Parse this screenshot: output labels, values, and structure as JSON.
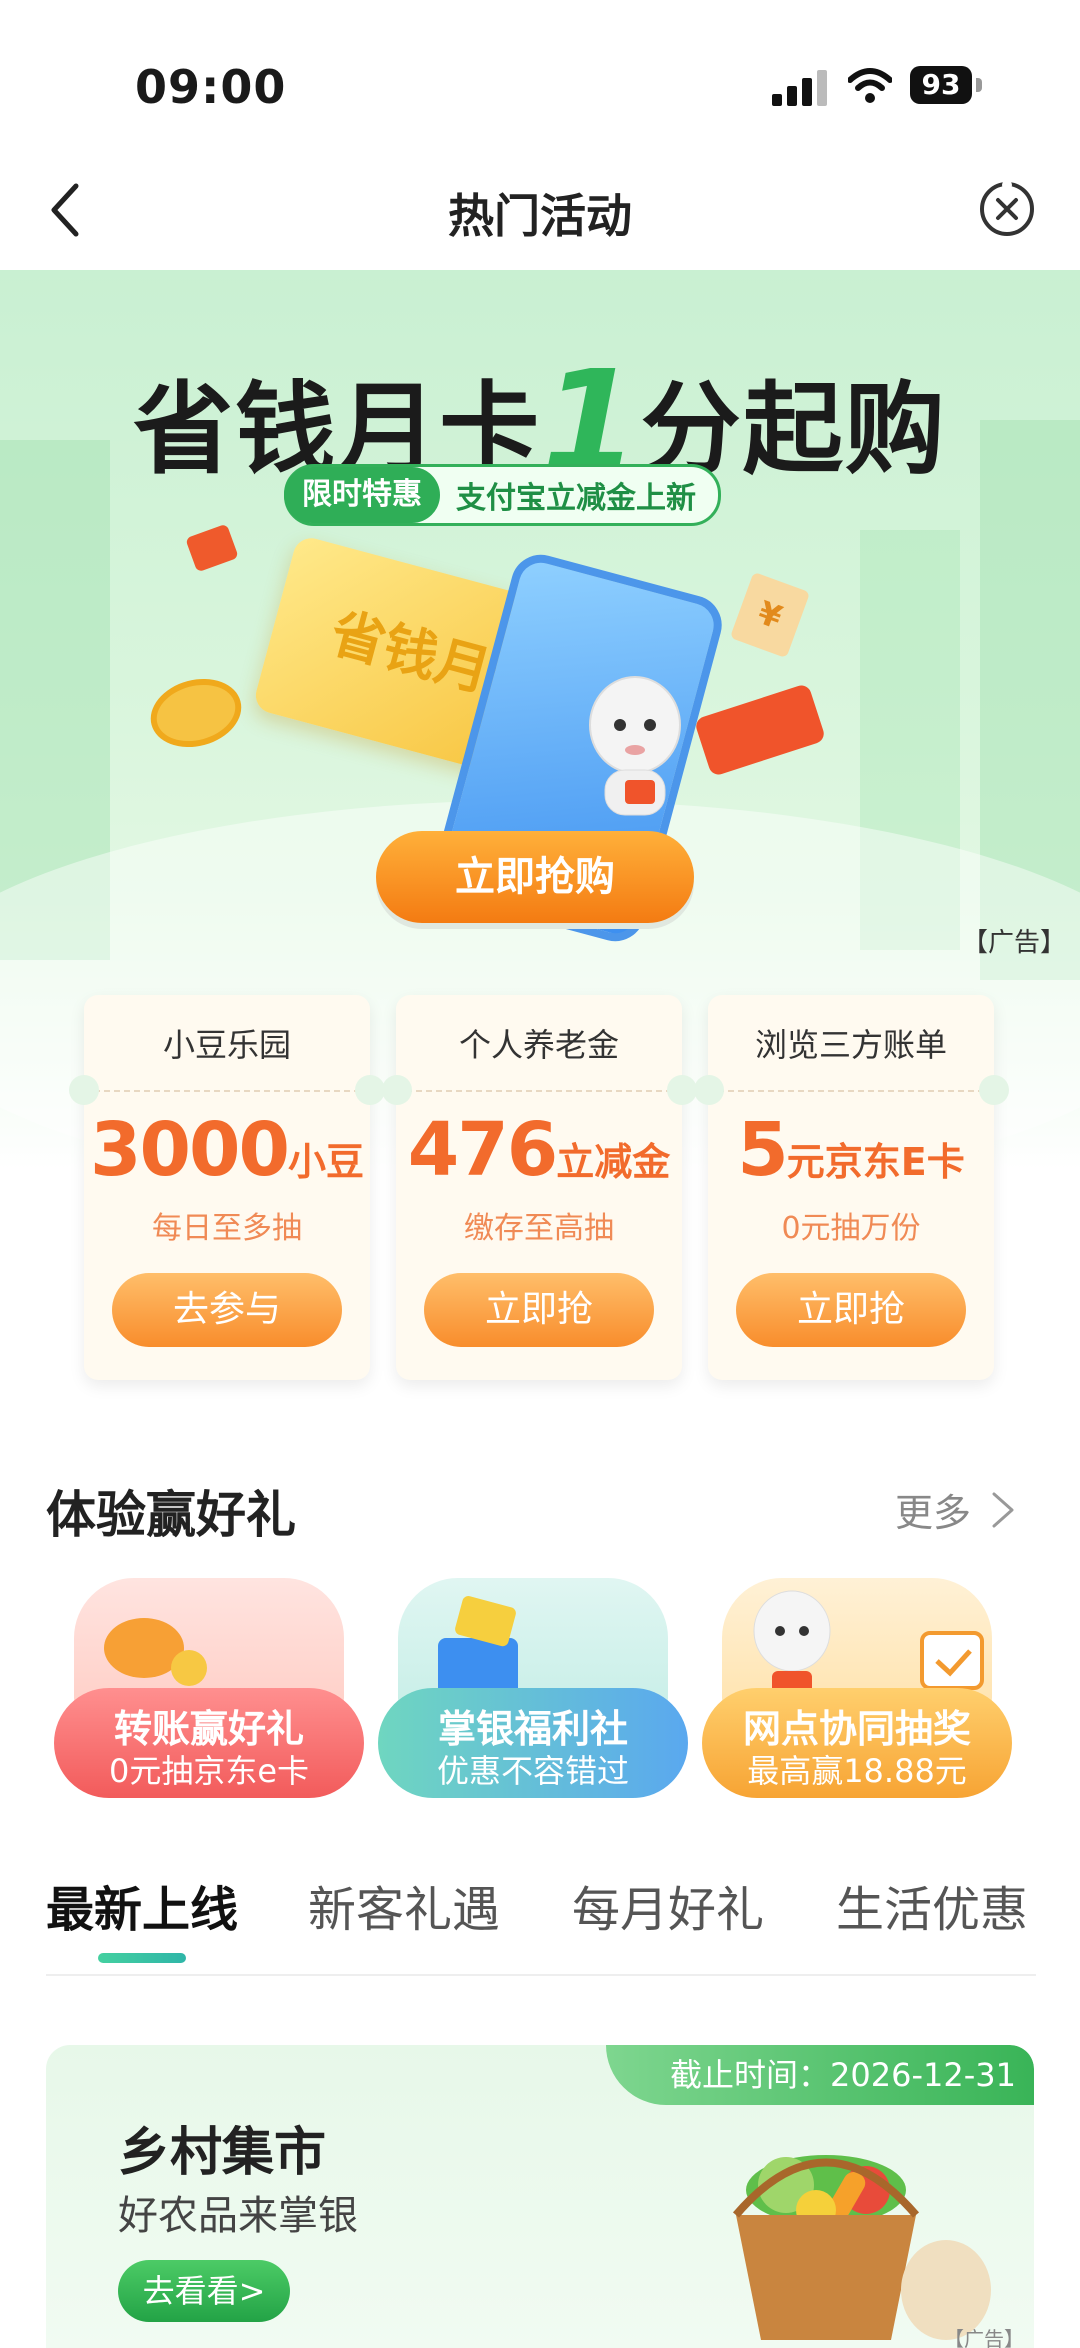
{
  "status": {
    "time": "09:00",
    "battery": "93"
  },
  "nav": {
    "title": "热门活动"
  },
  "hero": {
    "title_pre": "省钱月卡",
    "title_num": "1",
    "title_post": "分起购",
    "tag_chip": "限时特惠",
    "tag_text": "支付宝立减金上新",
    "ticket_text": "省钱月卡",
    "cta": "立即抢购",
    "ad": "【广告】"
  },
  "cards": [
    {
      "top": "小豆乐园",
      "big": "3000",
      "unit": "小豆",
      "sub": "每日至多抽",
      "btn": "去参与"
    },
    {
      "top": "个人养老金",
      "big": "476",
      "unit": "立减金",
      "sub": "缴存至高抽",
      "btn": "立即抢"
    },
    {
      "top": "浏览三方账单",
      "big": "5",
      "unit": "元京东E卡",
      "sub": "0元抽万份",
      "btn": "立即抢"
    }
  ],
  "section": {
    "title": "体验赢好礼",
    "more": "更多"
  },
  "gifts": [
    {
      "title": "转账赢好礼",
      "sub": "0元抽京东e卡"
    },
    {
      "title": "掌银福利社",
      "sub": "优惠不容错过"
    },
    {
      "title": "网点协同抽奖",
      "sub": "最高赢18.88元"
    }
  ],
  "tabs": [
    "最新上线",
    "新客礼遇",
    "每月好礼",
    "生活优惠"
  ],
  "feature": {
    "deadline": "截止时间：2026-12-31",
    "title": "乡村集市",
    "sub": "好农品来掌银",
    "btn": "去看看>",
    "ad": "【广告】"
  },
  "colors": {
    "accent_green": "#2fae57",
    "accent_orange": "#f47b12",
    "value_orange": "#f26b2c"
  }
}
